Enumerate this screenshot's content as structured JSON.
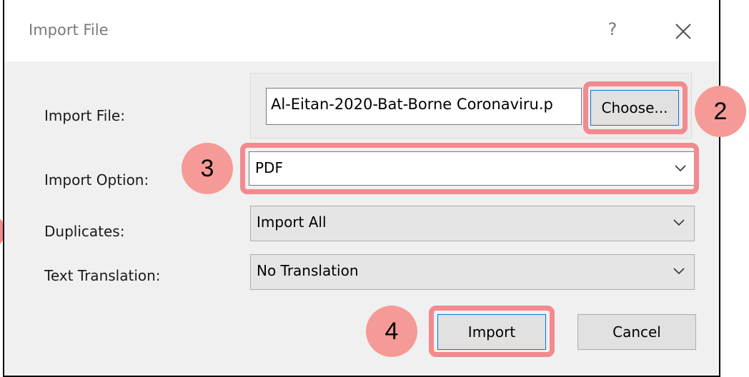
{
  "dialog": {
    "title": "Import File",
    "help_glyph": "?",
    "close_icon": "close-icon"
  },
  "fields": {
    "import_file_label": "Import File:",
    "import_file_value": "Al-Eitan-2020-Bat-Borne Coronaviru.p",
    "choose_label": "Choose...",
    "import_option_label": "Import Option:",
    "import_option_value": "PDF",
    "duplicates_label": "Duplicates:",
    "duplicates_value": "Import All",
    "translation_label": "Text Translation:",
    "translation_value": "No Translation"
  },
  "buttons": {
    "import_label": "Import",
    "cancel_label": "Cancel"
  },
  "annotations": {
    "step2": "2",
    "step3": "3",
    "step4": "4",
    "highlight_color": "#f28a8f",
    "badge_color": "#f59a96"
  }
}
